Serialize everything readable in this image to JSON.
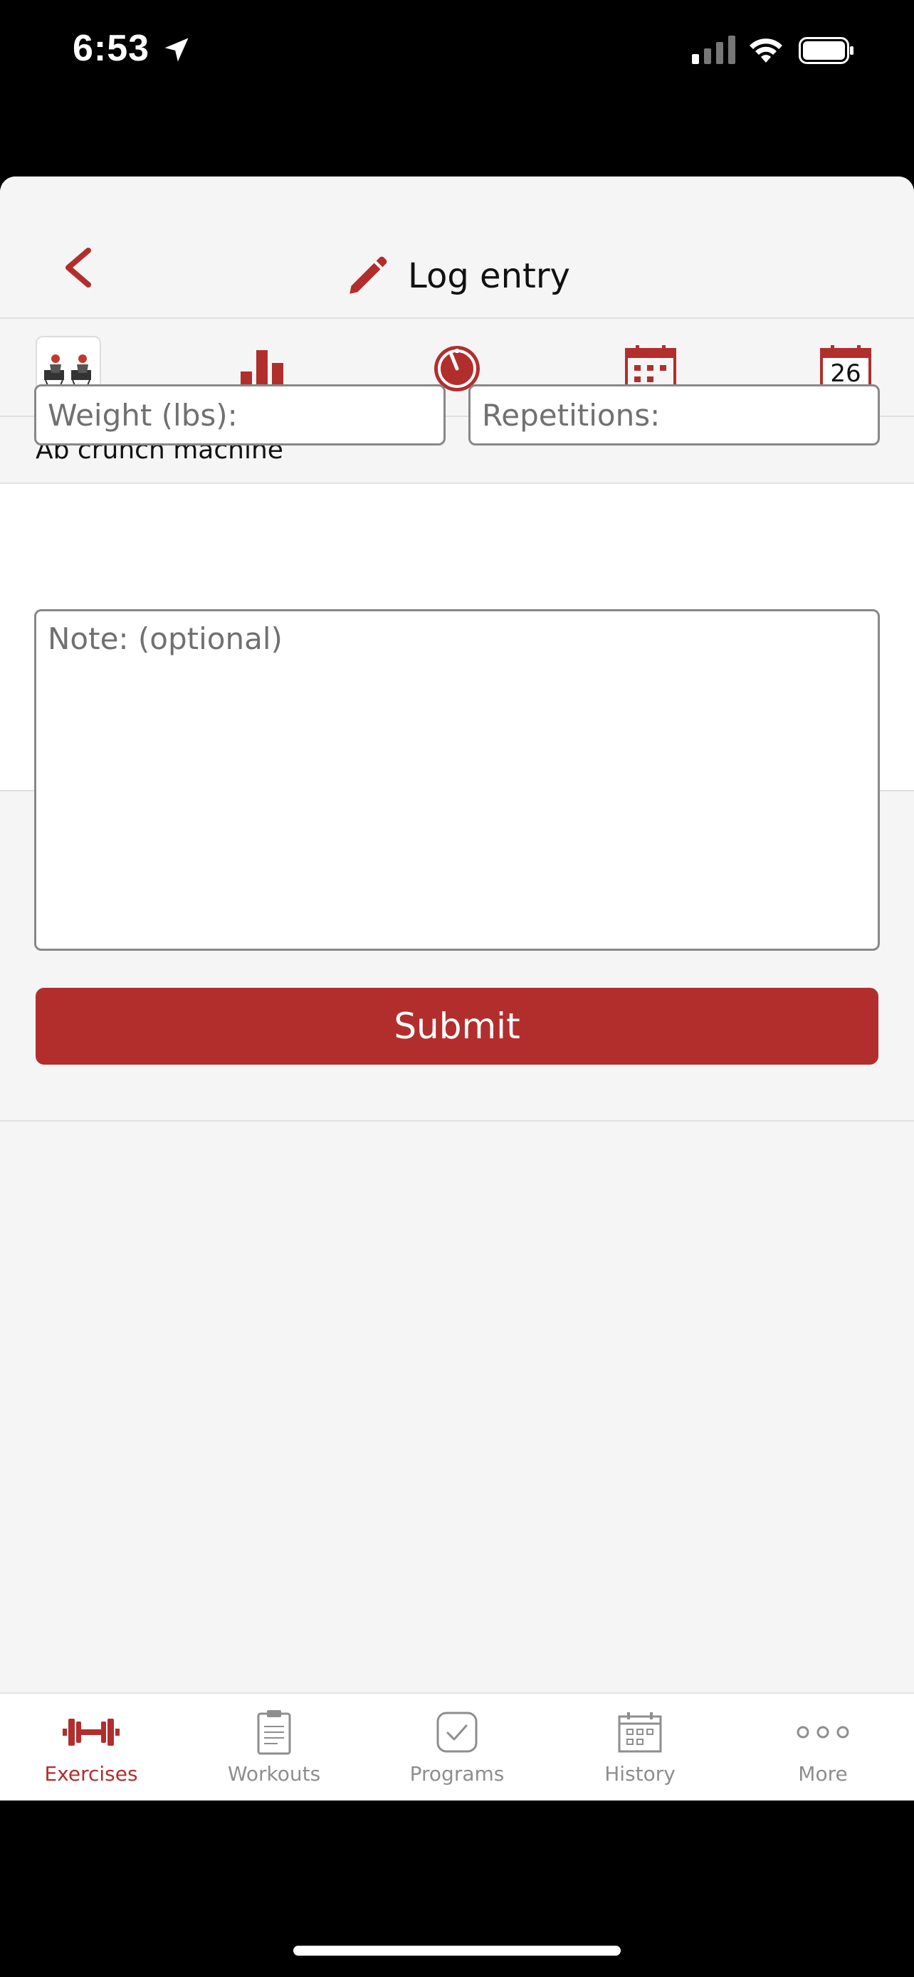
{
  "status": {
    "time": "6:53"
  },
  "header": {
    "title": "Log entry"
  },
  "toolbar": {
    "calendar_day": "26"
  },
  "exercise": {
    "name": "Ab crunch machine"
  },
  "form": {
    "weight_placeholder": "Weight (lbs):",
    "reps_placeholder": "Repetitions:",
    "note_placeholder": "Note: (optional)",
    "submit_label": "Submit"
  },
  "tabs": [
    {
      "label": "Exercises",
      "icon": "dumbbell-icon",
      "active": true
    },
    {
      "label": "Workouts",
      "icon": "clipboard-icon",
      "active": false
    },
    {
      "label": "Programs",
      "icon": "checkmark-icon",
      "active": false
    },
    {
      "label": "History",
      "icon": "calendar-icon",
      "active": false
    },
    {
      "label": "More",
      "icon": "more-icon",
      "active": false
    }
  ],
  "colors": {
    "accent": "#b22e2d",
    "inactive": "#8e8e8e",
    "background": "#f5f5f5"
  }
}
